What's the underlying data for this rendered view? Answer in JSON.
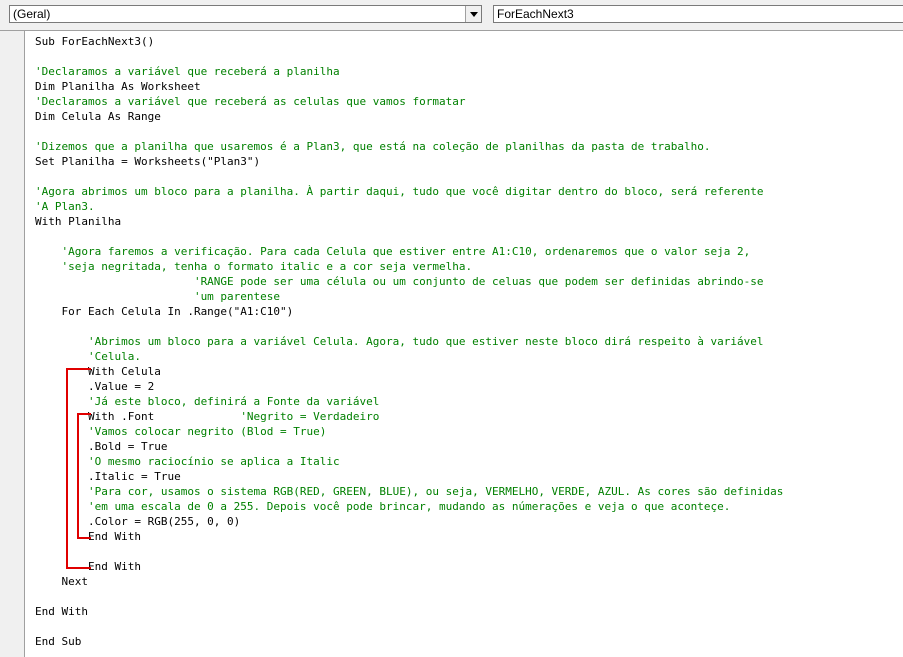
{
  "toolbar": {
    "object_combo": "(Geral)",
    "procedure_combo": "ForEachNext3"
  },
  "code_lines": [
    {
      "text": "Sub ForEachNext3()",
      "type": "code"
    },
    {
      "text": "",
      "type": "code"
    },
    {
      "text": "'Declaramos a variável que receberá a planilha",
      "type": "comment"
    },
    {
      "text": "Dim Planilha As Worksheet",
      "type": "code"
    },
    {
      "text": "'Declaramos a variável que receberá as celulas que vamos formatar",
      "type": "comment"
    },
    {
      "text": "Dim Celula As Range",
      "type": "code"
    },
    {
      "text": "",
      "type": "code"
    },
    {
      "text": "'Dizemos que a planilha que usaremos é a Plan3, que está na coleção de planilhas da pasta de trabalho.",
      "type": "comment"
    },
    {
      "text": "Set Planilha = Worksheets(\"Plan3\")",
      "type": "code"
    },
    {
      "text": "",
      "type": "code"
    },
    {
      "text": "'Agora abrimos um bloco para a planilha. À partir daqui, tudo que você digitar dentro do bloco, será referente",
      "type": "comment"
    },
    {
      "text": "'A Plan3.",
      "type": "comment"
    },
    {
      "text": "With Planilha",
      "type": "code"
    },
    {
      "text": "",
      "type": "code"
    },
    {
      "text": "    'Agora faremos a verificação. Para cada Celula que estiver entre A1:C10, ordenaremos que o valor seja 2,",
      "type": "comment"
    },
    {
      "text": "    'seja negritada, tenha o formato italic e a cor seja vermelha.",
      "type": "comment"
    },
    {
      "text": "                        'RANGE pode ser uma célula ou um conjunto de celuas que podem ser definidas abrindo-se",
      "type": "comment"
    },
    {
      "text": "                        'um parentese",
      "type": "comment"
    },
    {
      "text": "    For Each Celula In .Range(\"A1:C10\")",
      "type": "code"
    },
    {
      "text": "",
      "type": "code"
    },
    {
      "text": "        'Abrimos um bloco para a variável Celula. Agora, tudo que estiver neste bloco dirá respeito à variável",
      "type": "comment"
    },
    {
      "text": "        'Celula.",
      "type": "comment"
    },
    {
      "text": "        With Celula",
      "type": "code"
    },
    {
      "text": "        .Value = 2",
      "type": "code"
    },
    {
      "text": "        'Já este bloco, definirá a Fonte da variável",
      "type": "comment"
    },
    {
      "text": "        With .Font             ",
      "comment": "'Negrito = Verdadeiro",
      "type": "mixed"
    },
    {
      "text": "        'Vamos colocar negrito (Blod = True)",
      "type": "comment"
    },
    {
      "text": "        .Bold = True",
      "type": "code"
    },
    {
      "text": "        'O mesmo raciocínio se aplica a Italic",
      "type": "comment"
    },
    {
      "text": "        .Italic = True",
      "type": "code"
    },
    {
      "text": "        'Para cor, usamos o sistema RGB(RED, GREEN, BLUE), ou seja, VERMELHO, VERDE, AZUL. As cores são definidas",
      "type": "comment"
    },
    {
      "text": "        'em uma escala de 0 a 255. Depois você pode brincar, mudando as númerações e veja o que aconteçe.",
      "type": "comment"
    },
    {
      "text": "        .Color = RGB(255, 0, 0)",
      "type": "code"
    },
    {
      "text": "        End With",
      "type": "code"
    },
    {
      "text": "",
      "type": "code"
    },
    {
      "text": "        End With",
      "type": "code"
    },
    {
      "text": "    Next",
      "type": "code"
    },
    {
      "text": "",
      "type": "code"
    },
    {
      "text": "End With",
      "type": "code"
    },
    {
      "text": "",
      "type": "code"
    },
    {
      "text": "End Sub",
      "type": "code"
    }
  ],
  "colors": {
    "comment": "#008000",
    "keyword": "#000080",
    "annotation": "#e00000"
  }
}
